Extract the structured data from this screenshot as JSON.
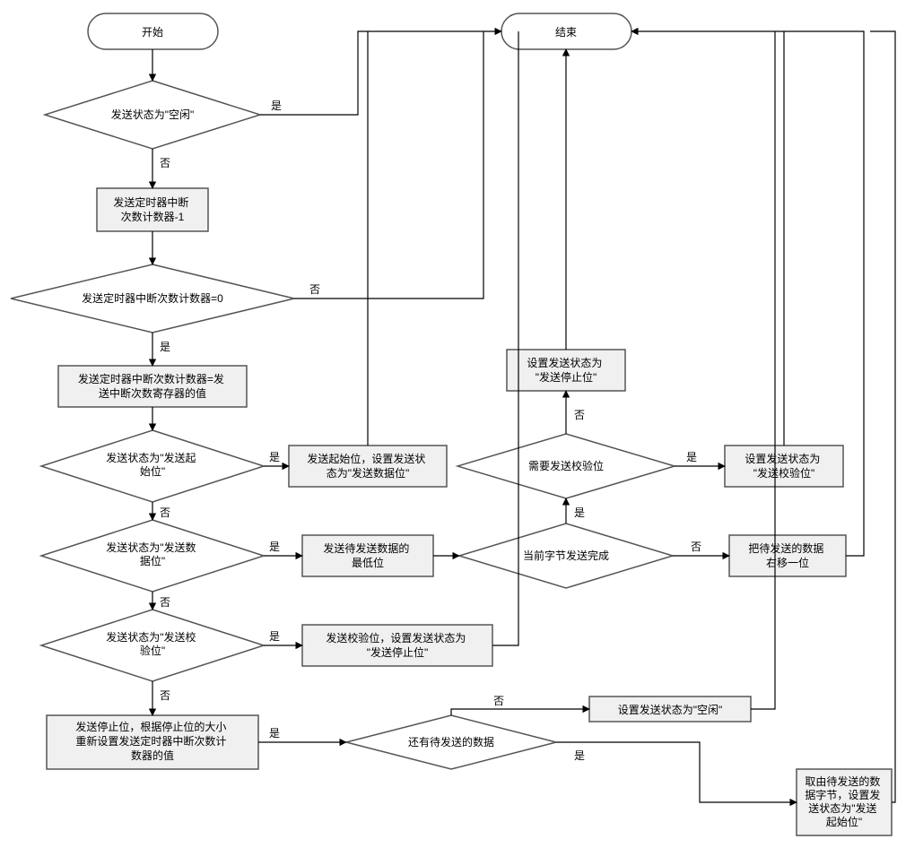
{
  "terminators": {
    "start": "开始",
    "end": "结束"
  },
  "decisions": {
    "state_idle": "发送状态为\"空闲\"",
    "counter_zero": "发送定时器中断次数计数器=0",
    "state_start_bit": "发送状态为\"发送起\n始位\"",
    "state_data_bit": "发送状态为\"发送数\n据位\"",
    "state_check_bit": "发送状态为\"发送校\n验位\"",
    "byte_done": "当前字节发送完成",
    "need_parity": "需要发送校验位",
    "more_data": "还有待发送的数据"
  },
  "processes": {
    "counter_dec": "发送定时器中断\n次数计数器-1",
    "counter_reload": "发送定时器中断次数计数器=发\n送中断次数寄存器的值",
    "send_start_set_data": "发送起始位，设置发送状\n态为\"发送数据位\"",
    "send_lowest_bit": "发送待发送数据的\n最低位",
    "shift_right": "把待发送的数据\n右移一位",
    "set_stop": "设置发送状态为\n\"发送停止位\"",
    "set_parity": "设置发送状态为\n\"发送校验位\"",
    "send_parity_set_stop": "发送校验位，设置发送状态为\n\"发送停止位\"",
    "send_stop_reset": "发送停止位，根据停止位的大小\n重新设置发送定时器中断次数计\n数器的值",
    "set_idle": "设置发送状态为\"空闲\"",
    "fetch_next": "取由待发送的数\n据字节，设置发\n送状态为\"发送\n起始位\""
  },
  "labels": {
    "yes": "是",
    "no": "否"
  }
}
